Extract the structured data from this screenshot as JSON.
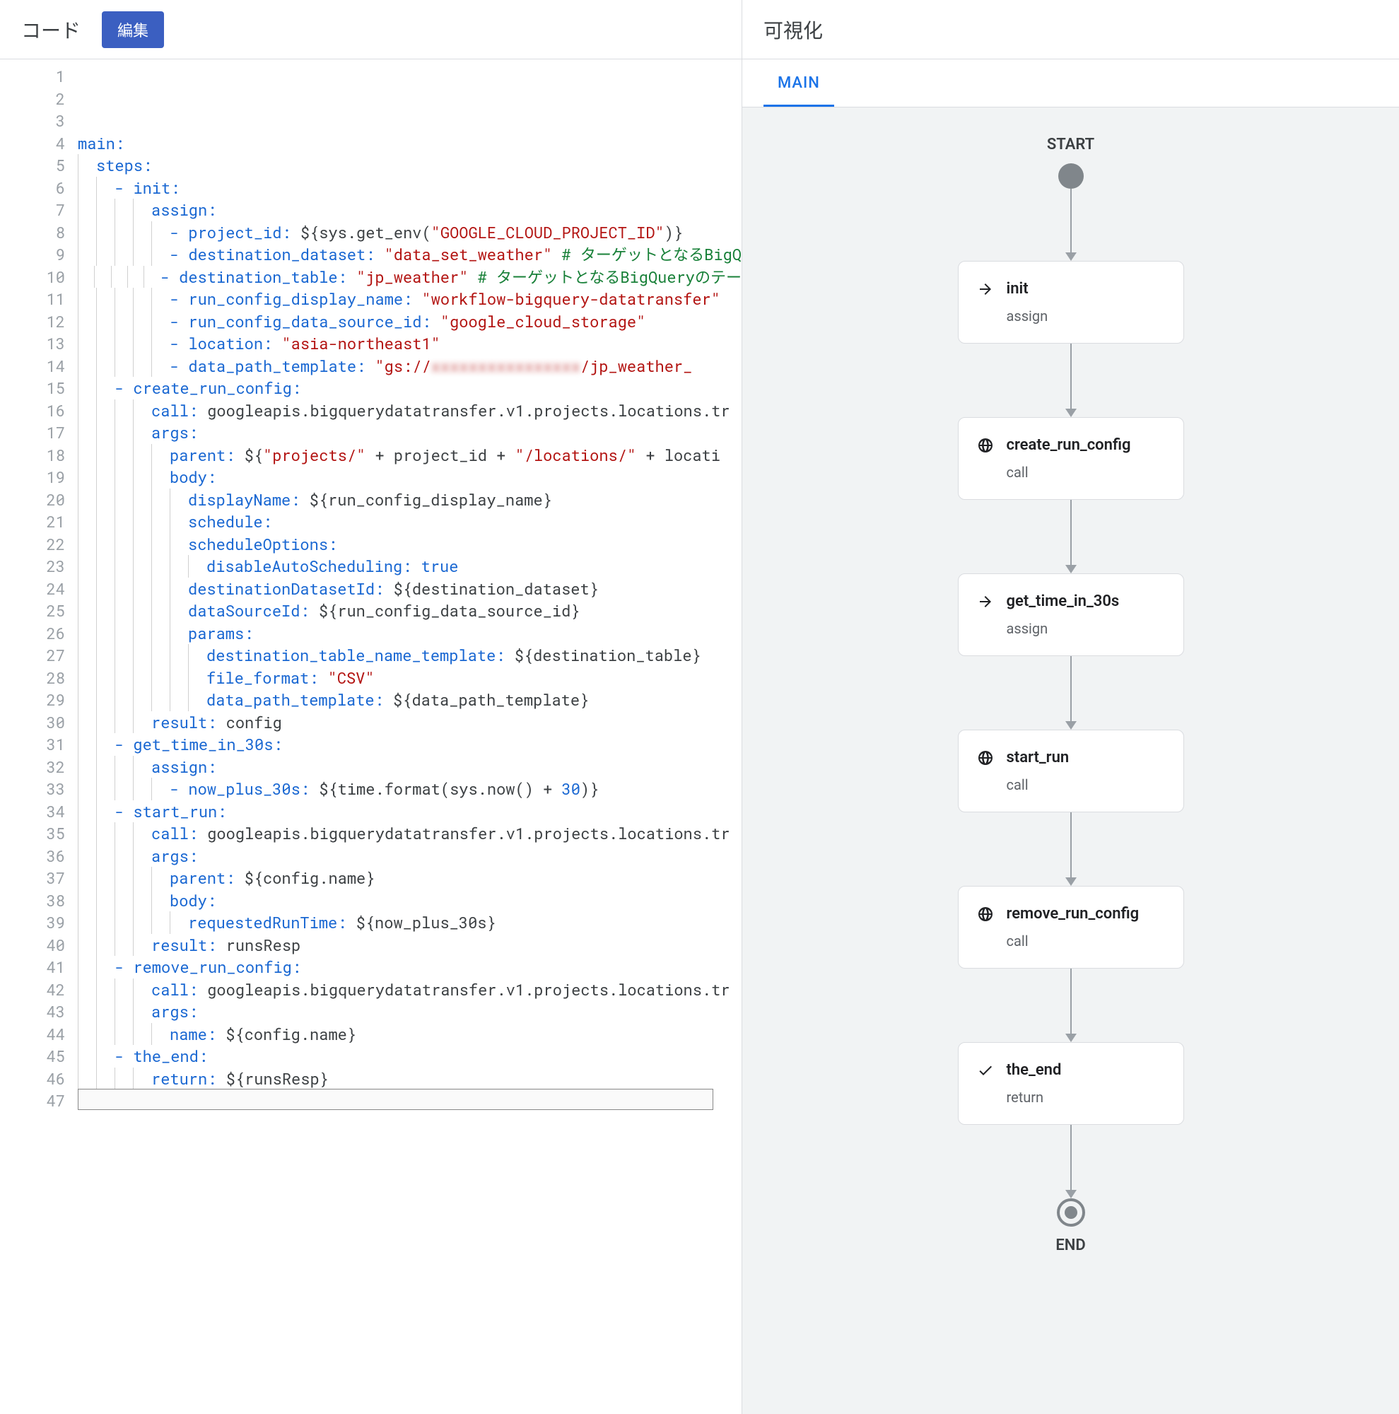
{
  "left": {
    "title": "コード",
    "edit_btn": "編集"
  },
  "right": {
    "title": "可視化",
    "tab": "MAIN",
    "start": "START",
    "end": "END",
    "nodes": [
      {
        "icon": "arrow",
        "title": "init",
        "sub": "assign"
      },
      {
        "icon": "globe",
        "title": "create_run_config",
        "sub": "call"
      },
      {
        "icon": "arrow",
        "title": "get_time_in_30s",
        "sub": "assign"
      },
      {
        "icon": "globe",
        "title": "start_run",
        "sub": "call"
      },
      {
        "icon": "globe",
        "title": "remove_run_config",
        "sub": "call"
      },
      {
        "icon": "check",
        "title": "the_end",
        "sub": "return"
      }
    ]
  },
  "code": {
    "total_lines": 47,
    "lines": [
      [
        0,
        [
          [
            "key",
            "main"
          ],
          [
            "punc",
            ":"
          ]
        ]
      ],
      [
        1,
        [
          [
            "key",
            "steps"
          ],
          [
            "punc",
            ":"
          ]
        ]
      ],
      [
        2,
        [
          [
            "punc",
            "- "
          ],
          [
            "key",
            "init"
          ],
          [
            "punc",
            ":"
          ]
        ]
      ],
      [
        4,
        [
          [
            "key",
            "assign"
          ],
          [
            "punc",
            ":"
          ]
        ]
      ],
      [
        5,
        [
          [
            "punc",
            "- "
          ],
          [
            "key",
            "project_id"
          ],
          [
            "punc",
            ": "
          ],
          [
            "plain",
            "${sys.get_env("
          ],
          [
            "str",
            "\"GOOGLE_CLOUD_PROJECT_ID\""
          ],
          [
            "plain",
            ")}"
          ]
        ]
      ],
      [
        5,
        [
          [
            "punc",
            "- "
          ],
          [
            "key",
            "destination_dataset"
          ],
          [
            "punc",
            ": "
          ],
          [
            "str",
            "\"data_set_weather\""
          ],
          [
            "plain",
            " "
          ],
          [
            "comment",
            "# ターゲットとなるBigQ"
          ]
        ]
      ],
      [
        5,
        [
          [
            "punc",
            "- "
          ],
          [
            "key",
            "destination_table"
          ],
          [
            "punc",
            ": "
          ],
          [
            "str",
            "\"jp_weather\""
          ],
          [
            "plain",
            " "
          ],
          [
            "comment",
            "# ターゲットとなるBigQueryのテー"
          ]
        ]
      ],
      [
        5,
        [
          [
            "punc",
            "- "
          ],
          [
            "key",
            "run_config_display_name"
          ],
          [
            "punc",
            ": "
          ],
          [
            "str",
            "\"workflow-bigquery-datatransfer\""
          ]
        ]
      ],
      [
        5,
        [
          [
            "punc",
            "- "
          ],
          [
            "key",
            "run_config_data_source_id"
          ],
          [
            "punc",
            ": "
          ],
          [
            "str",
            "\"google_cloud_storage\""
          ]
        ]
      ],
      [
        5,
        [
          [
            "punc",
            "- "
          ],
          [
            "key",
            "location"
          ],
          [
            "punc",
            ": "
          ],
          [
            "str",
            "\"asia-northeast1\""
          ]
        ]
      ],
      [
        5,
        [
          [
            "punc",
            "- "
          ],
          [
            "key",
            "data_path_template"
          ],
          [
            "punc",
            ": "
          ],
          [
            "str",
            "\"gs://"
          ],
          [
            "blur",
            "xxxxxxxxxxxxxxxx"
          ],
          [
            "str",
            "/jp_weather_"
          ]
        ]
      ],
      [
        2,
        [
          [
            "punc",
            "- "
          ],
          [
            "key",
            "create_run_config"
          ],
          [
            "punc",
            ":"
          ]
        ]
      ],
      [
        4,
        [
          [
            "key",
            "call"
          ],
          [
            "punc",
            ": "
          ],
          [
            "plain",
            "googleapis.bigquerydatatransfer.v1.projects.locations.tr"
          ]
        ]
      ],
      [
        4,
        [
          [
            "key",
            "args"
          ],
          [
            "punc",
            ":"
          ]
        ]
      ],
      [
        5,
        [
          [
            "key",
            "parent"
          ],
          [
            "punc",
            ": "
          ],
          [
            "plain",
            "${"
          ],
          [
            "str",
            "\"projects/\""
          ],
          [
            "plain",
            " + project_id + "
          ],
          [
            "str",
            "\"/locations/\""
          ],
          [
            "plain",
            " + locati"
          ]
        ]
      ],
      [
        5,
        [
          [
            "key",
            "body"
          ],
          [
            "punc",
            ":"
          ]
        ]
      ],
      [
        6,
        [
          [
            "key",
            "displayName"
          ],
          [
            "punc",
            ": "
          ],
          [
            "plain",
            "${run_config_display_name}"
          ]
        ]
      ],
      [
        6,
        [
          [
            "key",
            "schedule"
          ],
          [
            "punc",
            ":"
          ]
        ]
      ],
      [
        6,
        [
          [
            "key",
            "scheduleOptions"
          ],
          [
            "punc",
            ":"
          ]
        ]
      ],
      [
        7,
        [
          [
            "key",
            "disableAutoScheduling"
          ],
          [
            "punc",
            ": "
          ],
          [
            "bool",
            "true"
          ]
        ]
      ],
      [
        6,
        [
          [
            "key",
            "destinationDatasetId"
          ],
          [
            "punc",
            ": "
          ],
          [
            "plain",
            "${destination_dataset}"
          ]
        ]
      ],
      [
        6,
        [
          [
            "key",
            "dataSourceId"
          ],
          [
            "punc",
            ": "
          ],
          [
            "plain",
            "${run_config_data_source_id}"
          ]
        ]
      ],
      [
        6,
        [
          [
            "key",
            "params"
          ],
          [
            "punc",
            ":"
          ]
        ]
      ],
      [
        7,
        [
          [
            "key",
            "destination_table_name_template"
          ],
          [
            "punc",
            ": "
          ],
          [
            "plain",
            "${destination_table}"
          ]
        ]
      ],
      [
        7,
        [
          [
            "key",
            "file_format"
          ],
          [
            "punc",
            ": "
          ],
          [
            "str",
            "\"CSV\""
          ]
        ]
      ],
      [
        7,
        [
          [
            "key",
            "data_path_template"
          ],
          [
            "punc",
            ": "
          ],
          [
            "plain",
            "${data_path_template}"
          ]
        ]
      ],
      [
        4,
        [
          [
            "key",
            "result"
          ],
          [
            "punc",
            ": "
          ],
          [
            "plain",
            "config"
          ]
        ]
      ],
      [
        2,
        [
          [
            "punc",
            "- "
          ],
          [
            "key",
            "get_time_in_30s"
          ],
          [
            "punc",
            ":"
          ]
        ]
      ],
      [
        4,
        [
          [
            "key",
            "assign"
          ],
          [
            "punc",
            ":"
          ]
        ]
      ],
      [
        5,
        [
          [
            "punc",
            "- "
          ],
          [
            "key",
            "now_plus_30s"
          ],
          [
            "punc",
            ": "
          ],
          [
            "plain",
            "${time.format(sys.now() + "
          ],
          [
            "num",
            "30"
          ],
          [
            "plain",
            ")}"
          ]
        ]
      ],
      [
        2,
        [
          [
            "punc",
            "- "
          ],
          [
            "key",
            "start_run"
          ],
          [
            "punc",
            ":"
          ]
        ]
      ],
      [
        4,
        [
          [
            "key",
            "call"
          ],
          [
            "punc",
            ": "
          ],
          [
            "plain",
            "googleapis.bigquerydatatransfer.v1.projects.locations.tr"
          ]
        ]
      ],
      [
        4,
        [
          [
            "key",
            "args"
          ],
          [
            "punc",
            ":"
          ]
        ]
      ],
      [
        5,
        [
          [
            "key",
            "parent"
          ],
          [
            "punc",
            ": "
          ],
          [
            "plain",
            "${config.name}"
          ]
        ]
      ],
      [
        5,
        [
          [
            "key",
            "body"
          ],
          [
            "punc",
            ":"
          ]
        ]
      ],
      [
        6,
        [
          [
            "key",
            "requestedRunTime"
          ],
          [
            "punc",
            ": "
          ],
          [
            "plain",
            "${now_plus_30s}"
          ]
        ]
      ],
      [
        4,
        [
          [
            "key",
            "result"
          ],
          [
            "punc",
            ": "
          ],
          [
            "plain",
            "runsResp"
          ]
        ]
      ],
      [
        2,
        [
          [
            "punc",
            "- "
          ],
          [
            "key",
            "remove_run_config"
          ],
          [
            "punc",
            ":"
          ]
        ]
      ],
      [
        4,
        [
          [
            "key",
            "call"
          ],
          [
            "punc",
            ": "
          ],
          [
            "plain",
            "googleapis.bigquerydatatransfer.v1.projects.locations.tr"
          ]
        ]
      ],
      [
        4,
        [
          [
            "key",
            "args"
          ],
          [
            "punc",
            ":"
          ]
        ]
      ],
      [
        5,
        [
          [
            "key",
            "name"
          ],
          [
            "punc",
            ": "
          ],
          [
            "plain",
            "${config.name}"
          ]
        ]
      ],
      [
        2,
        [
          [
            "punc",
            "- "
          ],
          [
            "key",
            "the_end"
          ],
          [
            "punc",
            ":"
          ]
        ]
      ],
      [
        4,
        [
          [
            "key",
            "return"
          ],
          [
            "punc",
            ": "
          ],
          [
            "plain",
            "${runsResp}"
          ]
        ]
      ],
      [
        0,
        []
      ],
      [
        0,
        []
      ],
      [
        0,
        []
      ],
      [
        0,
        []
      ]
    ]
  }
}
